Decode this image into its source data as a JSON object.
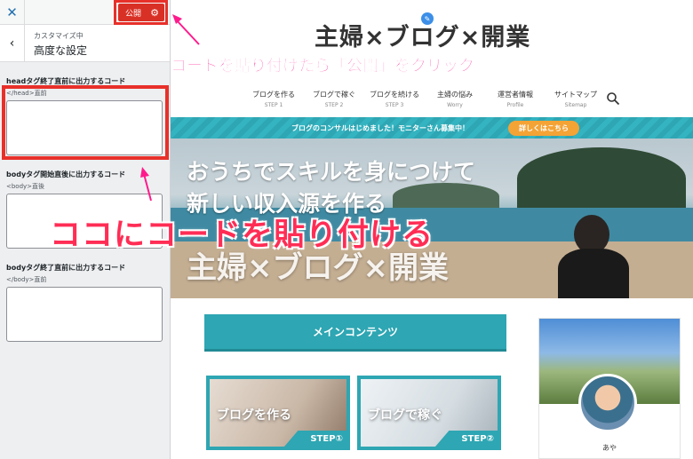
{
  "customizer": {
    "close_icon": "close-icon",
    "publish_label": "公開",
    "settings_icon": "gear-icon",
    "section_subtitle": "カスタマイズ中",
    "section_title": "高度な設定",
    "fields": [
      {
        "label": "headタグ終了直前に出力するコード",
        "description": "</head>直前",
        "value": ""
      },
      {
        "label": "bodyタグ開始直後に出力するコード",
        "description": "<body>直後",
        "value": ""
      },
      {
        "label": "bodyタグ終了直前に出力するコード",
        "description": "</body>直前",
        "value": ""
      }
    ]
  },
  "site": {
    "title": "主婦×ブログ×開業",
    "nav": [
      {
        "label": "ブログを作る",
        "sub": "STEP 1"
      },
      {
        "label": "ブログで稼ぐ",
        "sub": "STEP 2"
      },
      {
        "label": "ブログを続ける",
        "sub": "STEP 3"
      },
      {
        "label": "主婦の悩み",
        "sub": "Worry"
      },
      {
        "label": "運営者情報",
        "sub": "Profile"
      },
      {
        "label": "サイトマップ",
        "sub": "Sitemap"
      }
    ],
    "banner_text": "ブログのコンサルはじめました！モニターさん募集中！",
    "banner_button": "詳しくはこちら",
    "hero_line1": "おうちでスキルを身につけて",
    "hero_line2": "新しい収入源を作る",
    "hero_line3": "主婦×ブログ×開業",
    "main_heading": "メインコンテンツ",
    "cards": [
      {
        "title": "ブログを作る",
        "step": "STEP①"
      },
      {
        "title": "ブログで稼ぐ",
        "step": "STEP②"
      }
    ],
    "profile_name": "あや"
  },
  "annotations": {
    "top": "コードを貼り付けたら「公開」をクリック",
    "main": "ココにコードを貼り付ける"
  },
  "colors": {
    "accent": "#2ea6b3",
    "annotation_red": "#e8302a",
    "annotation_pink": "#ff1a8c",
    "banner_button": "#f4a335"
  }
}
